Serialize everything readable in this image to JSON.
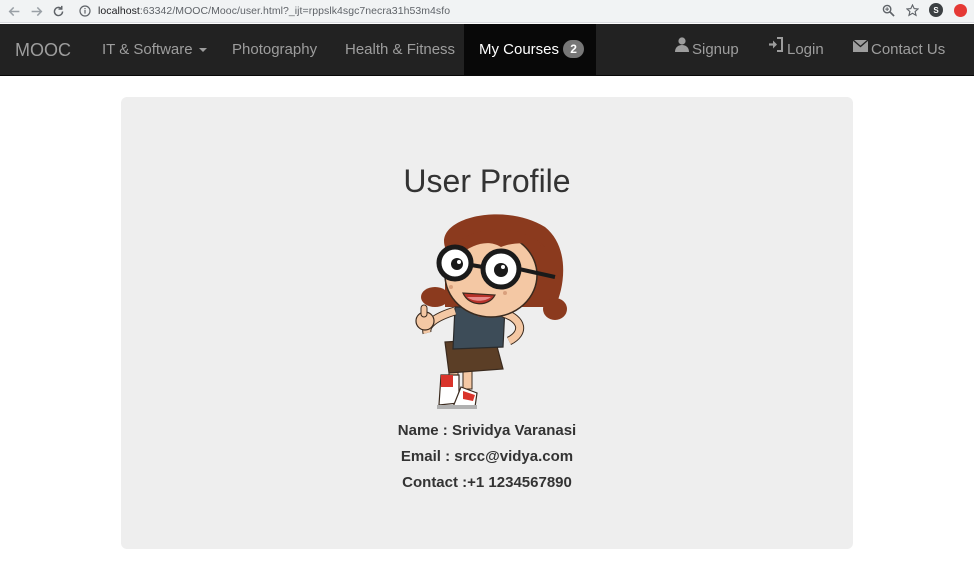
{
  "browser": {
    "url_host": "localhost",
    "url_rest": ":63342/MOOC/Mooc/user.html?_ijt=rppslk4sgc7necra31h53m4sfo",
    "profile_initial": "S"
  },
  "navbar": {
    "brand": "MOOC",
    "items": [
      {
        "label": "IT & Software"
      },
      {
        "label": "Photography"
      },
      {
        "label": "Health & Fitness"
      },
      {
        "label": "My Courses",
        "badge": "2"
      }
    ],
    "right": [
      {
        "label": "Signup",
        "icon": "user-icon"
      },
      {
        "label": "Login",
        "icon": "login-icon"
      },
      {
        "label": "Contact Us",
        "icon": "envelope-icon"
      }
    ]
  },
  "profile": {
    "title": "User Profile",
    "name_line": "Name : Srividya Varanasi",
    "email_line": "Email : srcc@vidya.com",
    "contact_line": "Contact :+1 1234567890"
  },
  "colors": {
    "navbar_bg": "#222222",
    "active_bg": "#080808",
    "jumbotron_bg": "#eeeeee"
  }
}
